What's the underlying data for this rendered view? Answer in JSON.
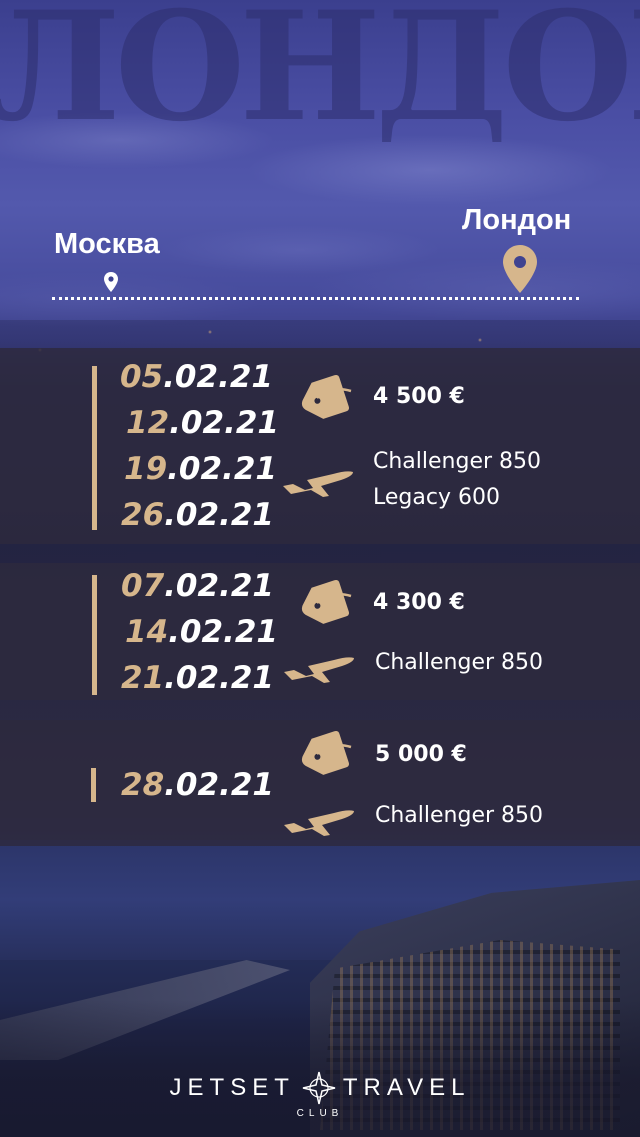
{
  "title_background": "ЛОНДОН",
  "route": {
    "from": "Москва",
    "to": "Лондон"
  },
  "colors": {
    "accent_gold": "#d6b68c",
    "panel_bg": "#2d2a3e"
  },
  "icons": {
    "origin_pin": "map-pin-icon",
    "destination_pin": "map-pin-icon",
    "price": "price-tag-icon",
    "aircraft": "airplane-icon"
  },
  "flights": [
    {
      "dates": [
        {
          "day": "05",
          "rest": ".02.21"
        },
        {
          "day": "12",
          "rest": ".02.21"
        },
        {
          "day": "19",
          "rest": ".02.21"
        },
        {
          "day": "26",
          "rest": ".02.21"
        }
      ],
      "price": "4 500 €",
      "aircraft": [
        "Challenger 850",
        "Legacy 600"
      ]
    },
    {
      "dates": [
        {
          "day": "07",
          "rest": ".02.21"
        },
        {
          "day": "14",
          "rest": ".02.21"
        },
        {
          "day": "21",
          "rest": ".02.21"
        }
      ],
      "price": "4 300 €",
      "aircraft": [
        "Challenger 850"
      ]
    },
    {
      "dates": [
        {
          "day": "28",
          "rest": ".02.21"
        }
      ],
      "price": "5 000 €",
      "aircraft": [
        "Challenger 850"
      ]
    }
  ],
  "brand": {
    "word_left": "JETSET",
    "word_right": "TRAVEL",
    "sub": "CLUB"
  }
}
